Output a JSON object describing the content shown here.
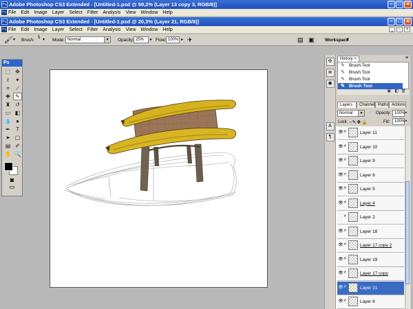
{
  "app": {
    "title_outer": "Adobe Photoshop CS3 Extended - [Untitled-1.psd @ 59,2% (Layer 13 copy 3, RGB/8)]",
    "title_inner": "Untitled-1.psd @ 20,3% (Layer 21, RGB/8)",
    "app_icon": "Ps"
  },
  "menu": [
    "File",
    "Edit",
    "Image",
    "Layer",
    "Select",
    "Filter",
    "Analysis",
    "View",
    "Window",
    "Help"
  ],
  "options": {
    "brush_label": "Brush:",
    "brush_size": "5",
    "mode_label": "Mode:",
    "mode_value": "Normal",
    "opacity_label": "Opacity:",
    "opacity_value": "25%",
    "flow_label": "Flow:",
    "flow_value": "100%",
    "workspace_label": "Workspace"
  },
  "toolbox": {
    "header": "Ps"
  },
  "history": {
    "tab": "History",
    "rows": [
      {
        "label": "Brush Tool",
        "selected": false
      },
      {
        "label": "Brush Tool",
        "selected": false
      },
      {
        "label": "Brush Tool",
        "selected": false
      },
      {
        "label": "Brush Tool",
        "selected": true
      }
    ]
  },
  "layers_panel": {
    "tabs": [
      "Layers",
      "Channels",
      "Paths",
      "Actions"
    ],
    "blend_mode": "Normal",
    "opacity_label": "Opacity:",
    "opacity_value": "100%",
    "lock_label": "Lock:",
    "fill_label": "Fill:",
    "fill_value": "100%",
    "layers": [
      {
        "name": "Layer 11",
        "visible": true,
        "selected": false,
        "underline": false
      },
      {
        "name": "Layer 10",
        "visible": true,
        "selected": false,
        "underline": false
      },
      {
        "name": "Layer 9",
        "visible": true,
        "selected": false,
        "underline": false
      },
      {
        "name": "Layer 6",
        "visible": true,
        "selected": false,
        "underline": false
      },
      {
        "name": "Layer 5",
        "visible": true,
        "selected": false,
        "underline": false
      },
      {
        "name": "Layer 4",
        "visible": true,
        "selected": false,
        "underline": true
      },
      {
        "name": "Layer 2",
        "visible": false,
        "selected": false,
        "underline": false
      },
      {
        "name": "Layer 18",
        "visible": true,
        "selected": false,
        "underline": false
      },
      {
        "name": "Layer 17 copy 2",
        "visible": true,
        "selected": false,
        "underline": true
      },
      {
        "name": "Layer 19",
        "visible": true,
        "selected": false,
        "underline": false
      },
      {
        "name": "Layer 17 copy",
        "visible": true,
        "selected": false,
        "underline": true
      },
      {
        "name": "Layer 21",
        "visible": true,
        "selected": true,
        "underline": false
      },
      {
        "name": "Layer 8",
        "visible": true,
        "selected": false,
        "underline": false
      }
    ]
  },
  "colors": {
    "titlebar": "#1f4fb8",
    "selection": "#3166c5",
    "workspace_bg": "#b9b9b9",
    "banana": "#d6b21f",
    "wood": "#6f6452",
    "sack": "#9a7558"
  }
}
